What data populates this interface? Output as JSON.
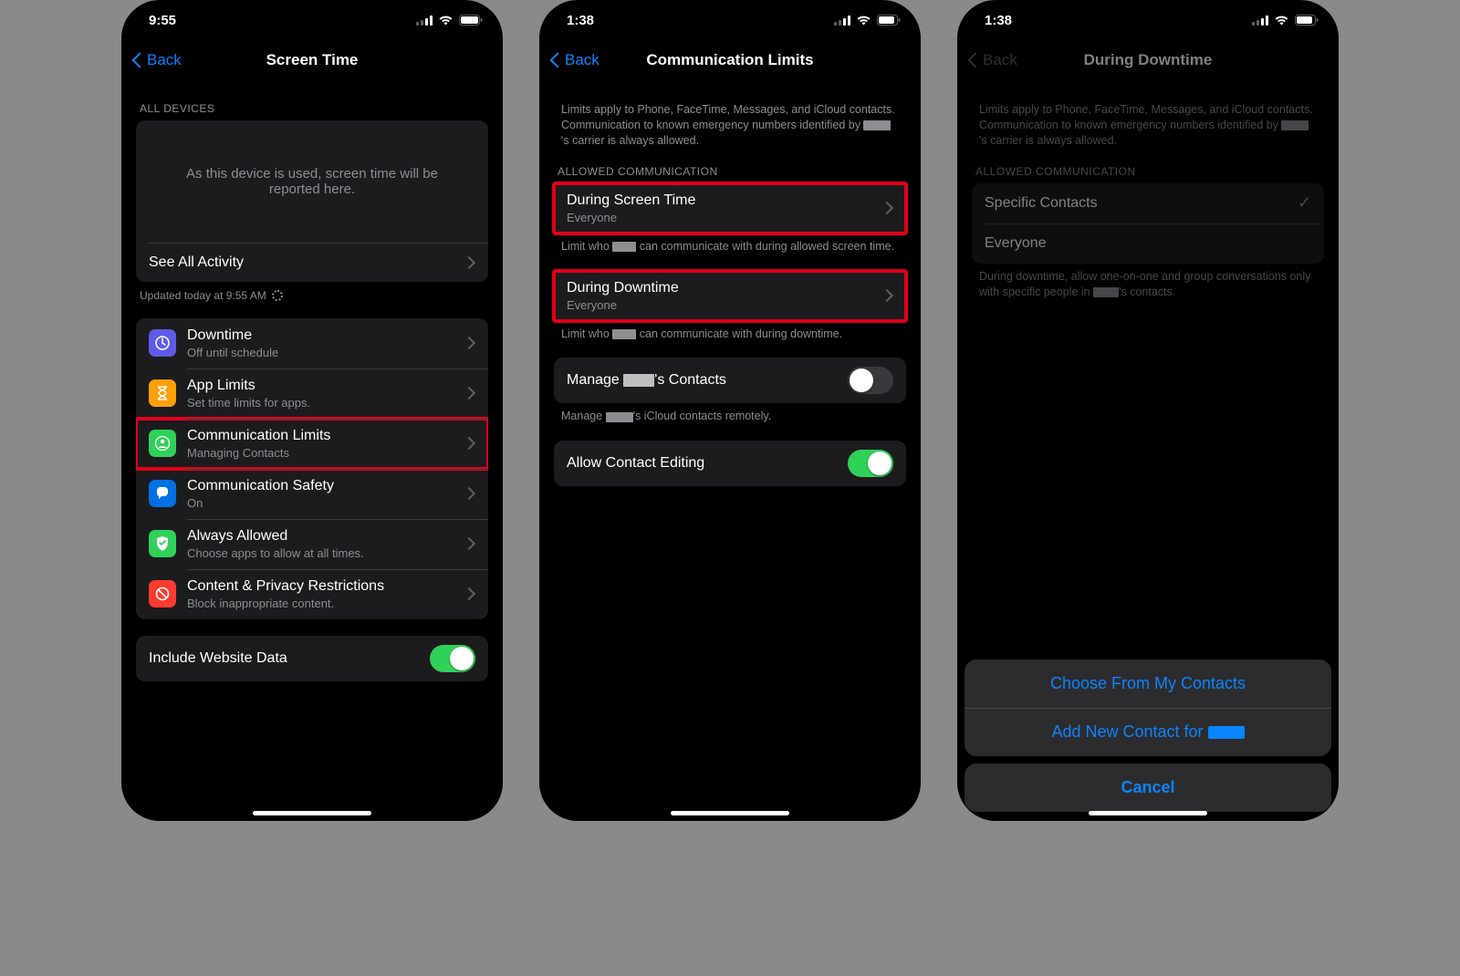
{
  "phones": [
    {
      "statusTime": "9:55",
      "backLabel": "Back",
      "navTitle": "Screen Time",
      "allDevicesHeader": "ALL DEVICES",
      "emptyMessage": "As this device is used, screen time will be reported here.",
      "seeAllActivity": "See All Activity",
      "updatedText": "Updated today at 9:55 AM",
      "rows": [
        {
          "title": "Downtime",
          "sub": "Off until schedule",
          "iconColor": "#5e5ce6"
        },
        {
          "title": "App Limits",
          "sub": "Set time limits for apps.",
          "iconColor": "#ff9f0a"
        },
        {
          "title": "Communication Limits",
          "sub": "Managing Contacts",
          "iconColor": "#30d158"
        },
        {
          "title": "Communication Safety",
          "sub": "On",
          "iconColor": "#0071e3"
        },
        {
          "title": "Always Allowed",
          "sub": "Choose apps to allow at all times.",
          "iconColor": "#30d158"
        },
        {
          "title": "Content & Privacy Restrictions",
          "sub": "Block inappropriate content.",
          "iconColor": "#ff3b30"
        }
      ],
      "includeWebsiteData": "Include Website Data"
    },
    {
      "statusTime": "1:38",
      "backLabel": "Back",
      "navTitle": "Communication Limits",
      "introPre": "Limits apply to Phone, FaceTime, Messages, and iCloud contacts. Communication to known emergency numbers identified by ",
      "introPost": "'s carrier is always allowed.",
      "allowedHeader": "ALLOWED COMMUNICATION",
      "duringScreenTime": "During Screen Time",
      "everyone": "Everyone",
      "footer1Pre": "Limit who ",
      "footer1Post": " can communicate with during allowed screen time.",
      "duringDowntime": "During Downtime",
      "footer2Pre": "Limit who ",
      "footer2Post": " can communicate with during downtime.",
      "manageContactsPre": "Manage ",
      "manageContactsPost": "'s Contacts",
      "manageFooterPre": "Manage ",
      "manageFooterPost": "'s iCloud contacts remotely.",
      "allowContactEditing": "Allow Contact Editing"
    },
    {
      "statusTime": "1:38",
      "backLabel": "Back",
      "navTitle": "During Downtime",
      "introPre": "Limits apply to Phone, FaceTime, Messages, and iCloud contacts. Communication to known emergency numbers identified by ",
      "introPost": "'s carrier is always allowed.",
      "allowedHeader": "ALLOWED COMMUNICATION",
      "specificContacts": "Specific Contacts",
      "everyone": "Everyone",
      "footerPre": "During downtime, allow one-on-one and group conversations only with specific people in ",
      "footerPost": "'s contacts.",
      "sheetChoose": "Choose From My Contacts",
      "sheetAddPre": "Add New Contact for ",
      "sheetCancel": "Cancel"
    }
  ]
}
